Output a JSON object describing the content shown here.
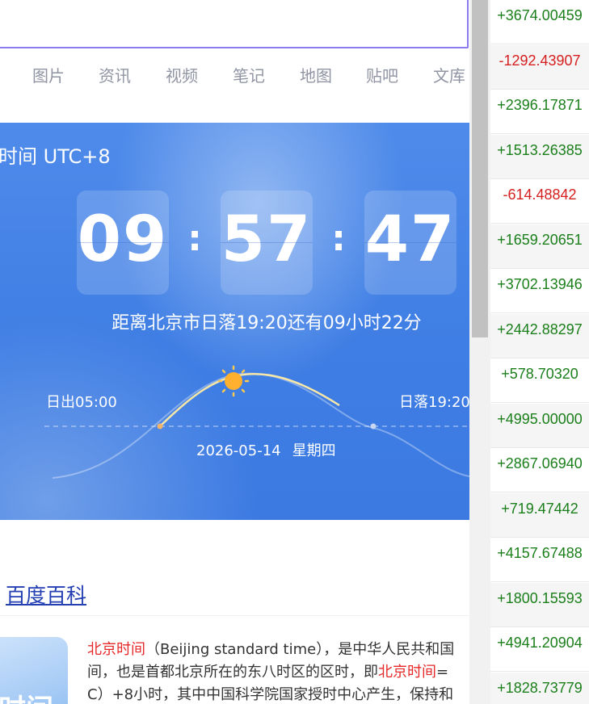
{
  "nav": {
    "tabs": [
      "图片",
      "资讯",
      "视频",
      "笔记",
      "地图",
      "贴吧",
      "文库"
    ]
  },
  "time_card": {
    "title": "时间 UTC+8",
    "hours": "09",
    "minutes": "57",
    "seconds": "47",
    "separator": ":",
    "sunset_countdown": "距离北京市日落19:20还有09小时22分",
    "sunrise": "日出05:00",
    "sunset": "日落19:20",
    "date": "2026-05-14",
    "weekday": "星期四"
  },
  "baike": {
    "link": "百度百科",
    "thumb_text": "时间",
    "desc_line1_hl": "北京时间",
    "desc_line1_rest": "（Beijing standard time），是中华人民共和国",
    "desc_line2_pre": "间，也是首都北京所在的东八时区的区时，即",
    "desc_line2_hl": "北京时间",
    "desc_line2_post": "=",
    "desc_line3": "C）+8小时，其中中国科学院国家授时中心产生，保持和"
  },
  "values": [
    {
      "text": "+3674.00459",
      "sign": "pos"
    },
    {
      "text": "-1292.43907",
      "sign": "neg"
    },
    {
      "text": "+2396.17871",
      "sign": "pos"
    },
    {
      "text": "+1513.26385",
      "sign": "pos"
    },
    {
      "text": "-614.48842",
      "sign": "neg"
    },
    {
      "text": "+1659.20651",
      "sign": "pos"
    },
    {
      "text": "+3702.13946",
      "sign": "pos"
    },
    {
      "text": "+2442.88297",
      "sign": "pos"
    },
    {
      "text": "+578.70320",
      "sign": "pos"
    },
    {
      "text": "+4995.00000",
      "sign": "pos"
    },
    {
      "text": "+2867.06940",
      "sign": "pos"
    },
    {
      "text": "+719.47442",
      "sign": "pos"
    },
    {
      "text": "+4157.67488",
      "sign": "pos"
    },
    {
      "text": "+1800.15593",
      "sign": "pos"
    },
    {
      "text": "+4941.20904",
      "sign": "pos"
    },
    {
      "text": "+1828.73779",
      "sign": "pos"
    }
  ],
  "colors": {
    "positive": "#1a7f1a",
    "negative": "#d61f1f",
    "card": "#4a86e8",
    "link": "#2440b3"
  }
}
